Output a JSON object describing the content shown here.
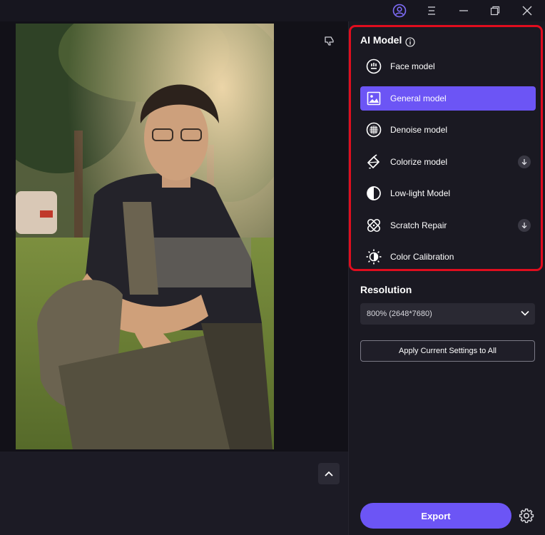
{
  "titlebar": {
    "icons": [
      "user-account-icon",
      "menu-icon",
      "minimize-icon",
      "restore-icon",
      "close-icon"
    ]
  },
  "canvas": {
    "feedback_icon": "thumbs-down-icon",
    "collapse_icon": "chevron-up-icon"
  },
  "panel": {
    "ai_model": {
      "title": "AI Model",
      "info_icon": "info-icon",
      "items": [
        {
          "label": "Face model",
          "icon": "face-icon",
          "active": false,
          "download": false
        },
        {
          "label": "General model",
          "icon": "image-icon",
          "active": true,
          "download": false
        },
        {
          "label": "Denoise model",
          "icon": "denoise-icon",
          "active": false,
          "download": false
        },
        {
          "label": "Colorize model",
          "icon": "paint-bucket-icon",
          "active": false,
          "download": true
        },
        {
          "label": "Low-light Model",
          "icon": "contrast-icon",
          "active": false,
          "download": false
        },
        {
          "label": "Scratch Repair",
          "icon": "bandage-icon",
          "active": false,
          "download": true
        },
        {
          "label": "Color Calibration",
          "icon": "brightness-icon",
          "active": false,
          "download": false
        }
      ]
    },
    "resolution": {
      "title": "Resolution",
      "selected": "800% (2648*7680)"
    },
    "apply_label": "Apply Current Settings to All",
    "export_label": "Export",
    "settings_icon": "gear-icon"
  },
  "colors": {
    "accent": "#6c55f5",
    "highlight_border": "#e00d1e",
    "panel_bg": "#1a1922",
    "canvas_bg": "#121118"
  }
}
